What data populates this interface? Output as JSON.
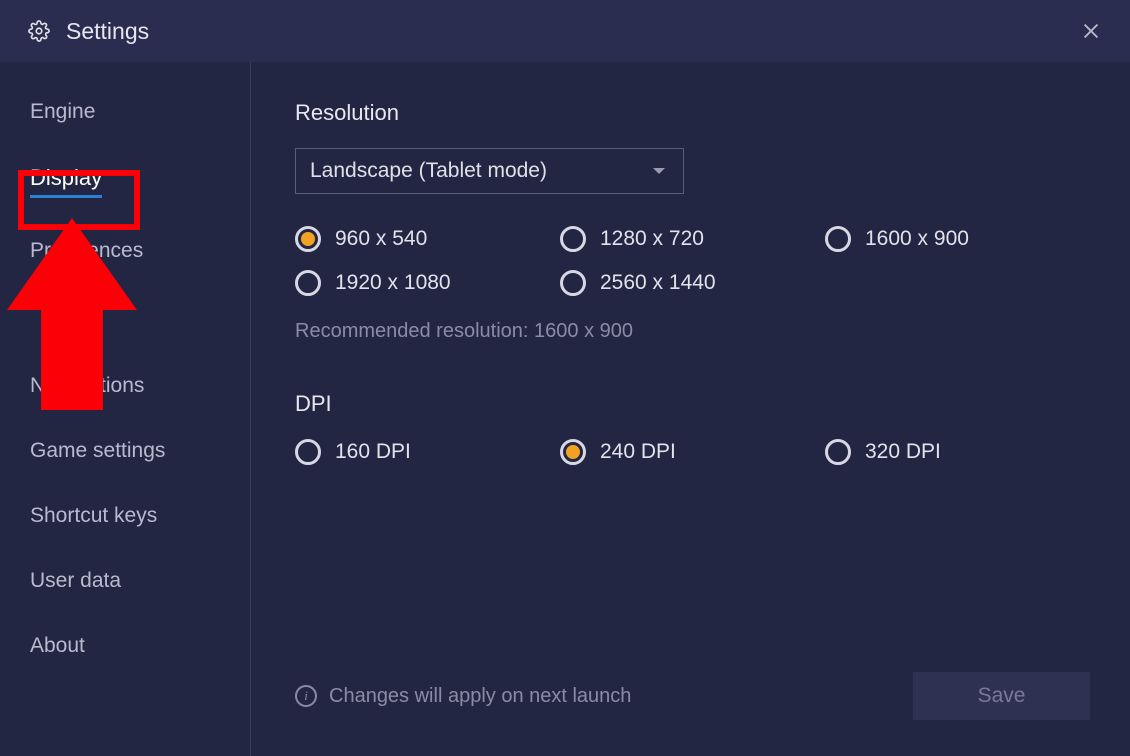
{
  "header": {
    "title": "Settings"
  },
  "sidebar": {
    "items": [
      {
        "label": "Engine",
        "active": false
      },
      {
        "label": "Display",
        "active": true
      },
      {
        "label": "Preferences",
        "active": false
      },
      {
        "label": "",
        "active": false
      },
      {
        "label": "Notifications",
        "active": false
      },
      {
        "label": "Game settings",
        "active": false
      },
      {
        "label": "Shortcut keys",
        "active": false
      },
      {
        "label": "User data",
        "active": false
      },
      {
        "label": "About",
        "active": false
      }
    ]
  },
  "resolution": {
    "title": "Resolution",
    "dropdown_value": "Landscape (Tablet mode)",
    "options": [
      {
        "label": "960 x 540",
        "selected": true
      },
      {
        "label": "1280 x 720",
        "selected": false
      },
      {
        "label": "1600 x 900",
        "selected": false
      },
      {
        "label": "1920 x 1080",
        "selected": false
      },
      {
        "label": "2560 x 1440",
        "selected": false
      }
    ],
    "recommended": "Recommended resolution: 1600 x 900"
  },
  "dpi": {
    "title": "DPI",
    "options": [
      {
        "label": "160 DPI",
        "selected": false
      },
      {
        "label": "240 DPI",
        "selected": true
      },
      {
        "label": "320 DPI",
        "selected": false
      }
    ]
  },
  "footer": {
    "info_text": "Changes will apply on next launch",
    "save_label": "Save"
  }
}
